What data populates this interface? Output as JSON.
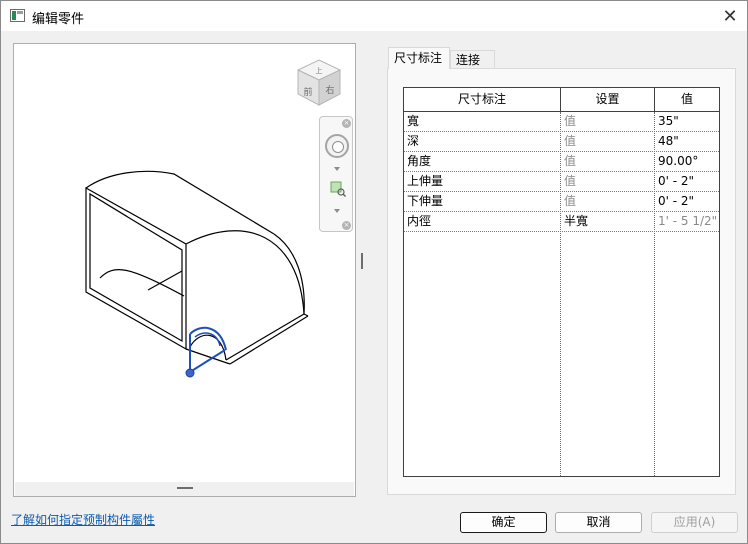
{
  "window": {
    "title": "编辑零件",
    "close_glyph": "✕"
  },
  "viewcube": {
    "face_top": "上",
    "face_left": "前",
    "face_right": "右"
  },
  "tabs": [
    {
      "label": "尺寸标注",
      "active": true
    },
    {
      "label": "连接件",
      "active": false
    }
  ],
  "table": {
    "headers": [
      "尺寸标注",
      "设置",
      "值"
    ],
    "rows": [
      {
        "name": "寬",
        "setting": "值",
        "value": "35\""
      },
      {
        "name": "深",
        "setting": "值",
        "value": "48\""
      },
      {
        "name": "角度",
        "setting": "值",
        "value": "90.00°"
      },
      {
        "name": "上伸量",
        "setting": "值",
        "value": "0' - 2\""
      },
      {
        "name": "下伸量",
        "setting": "值",
        "value": "0' - 2\""
      },
      {
        "name": "内徑",
        "setting": "半寬",
        "value": "1' - 5 1/2\""
      }
    ]
  },
  "footer": {
    "help_link": "了解如何指定预制构件屬性",
    "ok": "确定",
    "cancel": "取消",
    "apply": "应用(A)"
  },
  "colors": {
    "accent_blue": "#1f4fbf",
    "link": "#0b5cad"
  }
}
